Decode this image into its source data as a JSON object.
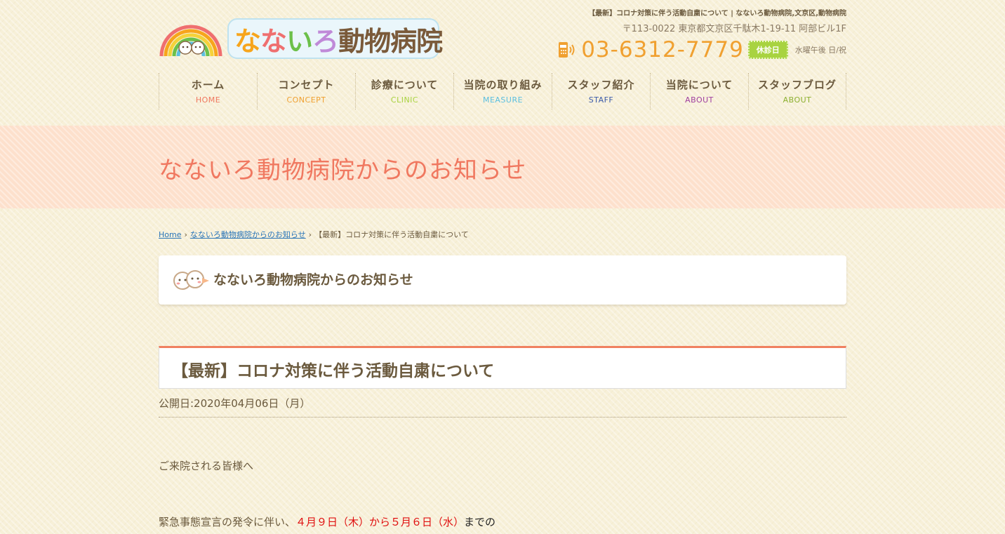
{
  "header": {
    "logo_main": [
      "な",
      "な",
      "い",
      "ろ",
      "動",
      "物",
      "病",
      "院"
    ],
    "logo_colors": [
      "#f7a51c",
      "#ef6f6f",
      "#6cc04a",
      "#c08ad8",
      "#7a5a3a",
      "#7a5a3a",
      "#7a5a3a",
      "#7a5a3a"
    ],
    "logo_badge_text": "nanairo animal hospital",
    "tagline": "【最新】コロナ対策に伴う活動自粛について | なないろ動物病院,文京区,動物病院",
    "address": "〒113-0022 東京都文京区千駄木1-19-11 阿部ビル1F",
    "phone": "03-6312-7779",
    "holiday_label": "休診日",
    "holiday_text": "水曜午後 日/祝"
  },
  "nav": [
    {
      "jp": "ホーム",
      "en": "HOME",
      "color": "#f07860"
    },
    {
      "jp": "コンセプト",
      "en": "CONCEPT",
      "color": "#f0a030"
    },
    {
      "jp": "診療について",
      "en": "CLINIC",
      "color": "#a8d340"
    },
    {
      "jp": "当院の取り組み",
      "en": "MEASURE",
      "color": "#5bbfe0"
    },
    {
      "jp": "スタッフ紹介",
      "en": "STAFF",
      "color": "#3b5aa8"
    },
    {
      "jp": "当院について",
      "en": "ABOUT",
      "color": "#a040a0"
    },
    {
      "jp": "スタッフブログ",
      "en": "ABOUT",
      "color": "#8cb030"
    }
  ],
  "banner": {
    "title": "なないろ動物病院からのお知らせ"
  },
  "breadcrumb": {
    "home": "Home",
    "parent": "なないろ動物病院からのお知らせ",
    "current": "【最新】コロナ対策に伴う活動自粛について",
    "sep": "›"
  },
  "section": {
    "title": "なないろ動物病院からのお知らせ"
  },
  "article": {
    "title": "【最新】コロナ対策に伴う活動自粛について",
    "pubdate": "公開日:2020年04月06日（月）",
    "p1": "ご来院される皆様へ",
    "p2_prefix": "緊急事態宣言の発令に伴い、",
    "p2_dates": "４月９日（木）から５月６日（水）",
    "p2_suffix": "までの"
  }
}
